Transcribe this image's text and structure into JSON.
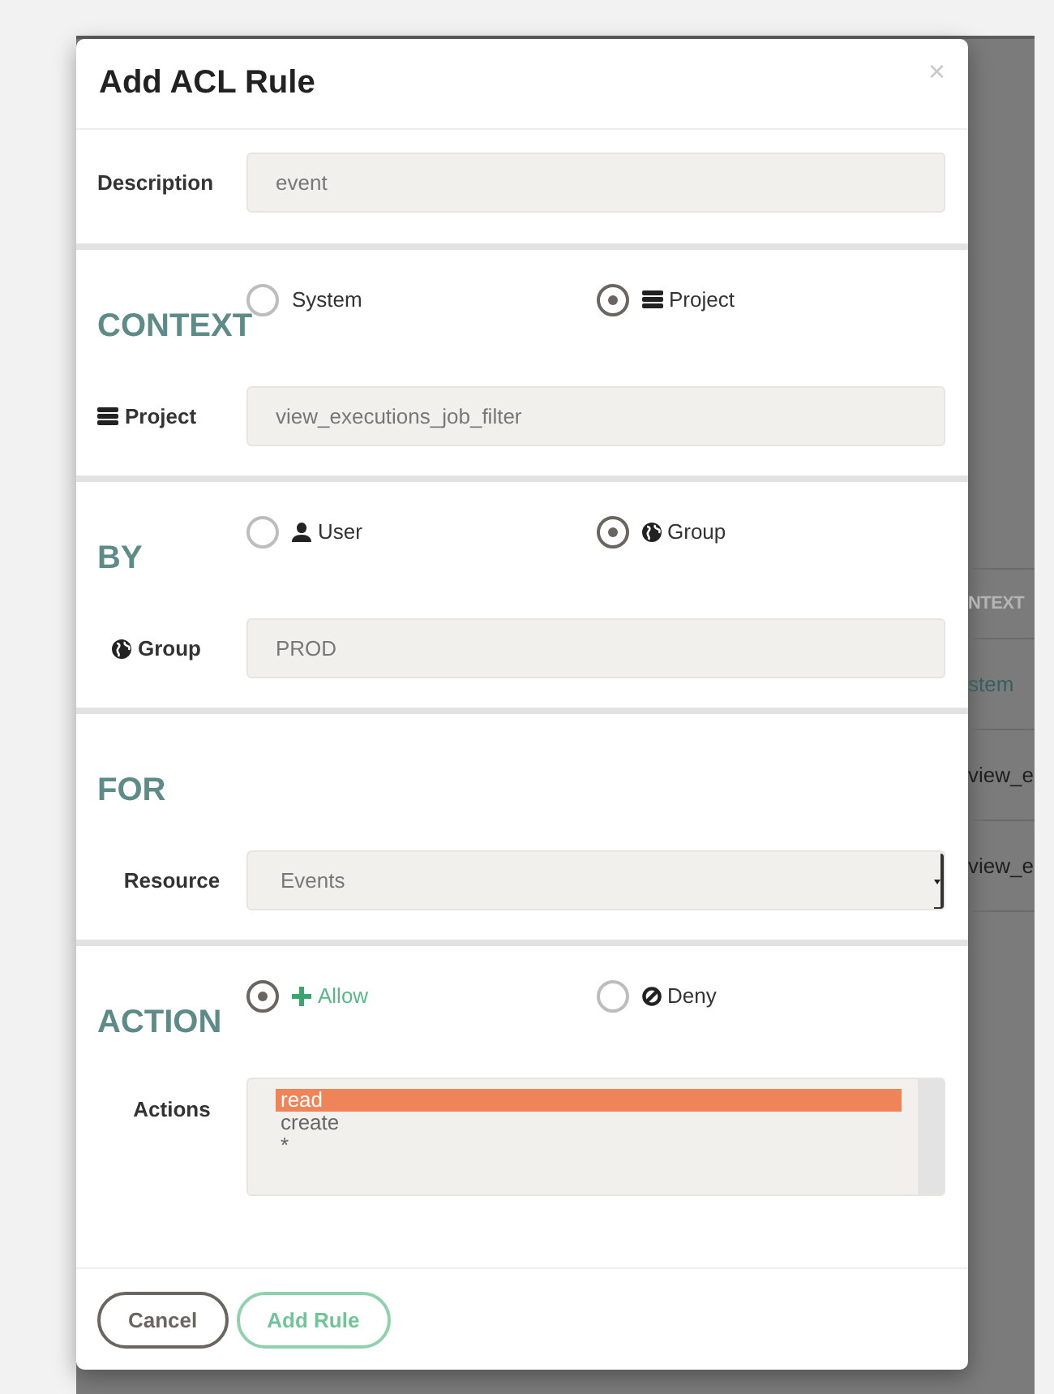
{
  "dialog": {
    "title": "Add ACL Rule",
    "close": "×"
  },
  "description": {
    "label": "Description",
    "value": "event"
  },
  "context": {
    "heading": "CONTEXT",
    "options": [
      {
        "label": "System",
        "selected": false
      },
      {
        "label": "Project",
        "selected": true
      }
    ],
    "field": {
      "label": "Project",
      "value": "view_executions_job_filter"
    }
  },
  "by": {
    "heading": "BY",
    "options": [
      {
        "label": "User",
        "selected": false
      },
      {
        "label": "Group",
        "selected": true
      }
    ],
    "field": {
      "label": "Group",
      "value": "PROD"
    }
  },
  "for": {
    "heading": "FOR",
    "field": {
      "label": "Resource",
      "value": "Events"
    }
  },
  "action": {
    "heading": "ACTION",
    "options": [
      {
        "label": "Allow",
        "selected": true
      },
      {
        "label": "Deny",
        "selected": false
      }
    ],
    "field": {
      "label": "Actions",
      "items": [
        {
          "label": "read",
          "selected": true
        },
        {
          "label": "create",
          "selected": false
        },
        {
          "label": "*",
          "selected": false
        }
      ]
    }
  },
  "buttons": [
    {
      "label": "Cancel",
      "kind": "secondary"
    },
    {
      "label": "Add Rule",
      "kind": "primary"
    }
  ],
  "background_table": {
    "header": "NTEXT",
    "cells": [
      "stem",
      "view_e",
      "view_e"
    ]
  }
}
